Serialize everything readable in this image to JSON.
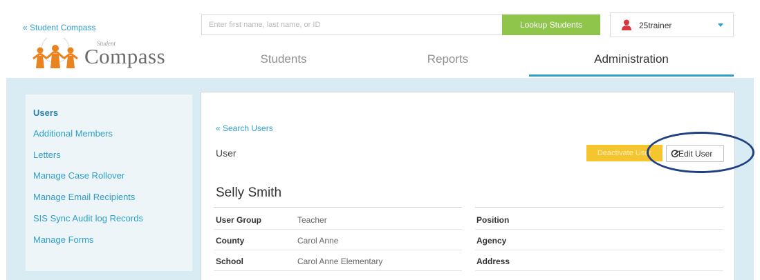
{
  "header": {
    "back_link": "« Student Compass",
    "logo_small": "Student",
    "logo_word": "Compass",
    "search_placeholder": "Enter first name, last name, or ID",
    "lookup_label": "Lookup Students",
    "username": "25trainer",
    "tabs": [
      {
        "label": "Students"
      },
      {
        "label": "Reports"
      },
      {
        "label": "Administration",
        "active": true
      }
    ]
  },
  "sidebar": {
    "items": [
      {
        "label": "Users",
        "active": true
      },
      {
        "label": "Additional Members"
      },
      {
        "label": "Letters"
      },
      {
        "label": "Manage Case Rollover"
      },
      {
        "label": "Manage Email Recipients"
      },
      {
        "label": "SIS Sync Audit log Records"
      },
      {
        "label": "Manage Forms"
      }
    ]
  },
  "main": {
    "back_link": "« Search Users",
    "section_title": "User",
    "deactivate_label": "Deactivate User",
    "edit_label": "Edit User",
    "person_name": "Selly Smith",
    "left_fields": [
      {
        "label": "User Group",
        "value": "Teacher"
      },
      {
        "label": "County",
        "value": "Carol Anne"
      },
      {
        "label": "School",
        "value": "Carol Anne Elementary"
      }
    ],
    "right_fields": [
      {
        "label": "Position",
        "value": ""
      },
      {
        "label": "Agency",
        "value": ""
      },
      {
        "label": "Address",
        "value": ""
      }
    ]
  },
  "colors": {
    "accent_blue": "#2f9fc9",
    "lookup_green": "#8fc54b",
    "deactivate_yellow": "#f5c52f",
    "band_blue": "#d9ebf3",
    "highlight_ring": "#1e3f82",
    "logo_orange": "#e8831f"
  },
  "icons": {
    "user_menu": "person-icon",
    "edit": "edit-icon",
    "dropdown": "caret-down-icon",
    "logo": "family-logo-icon"
  }
}
